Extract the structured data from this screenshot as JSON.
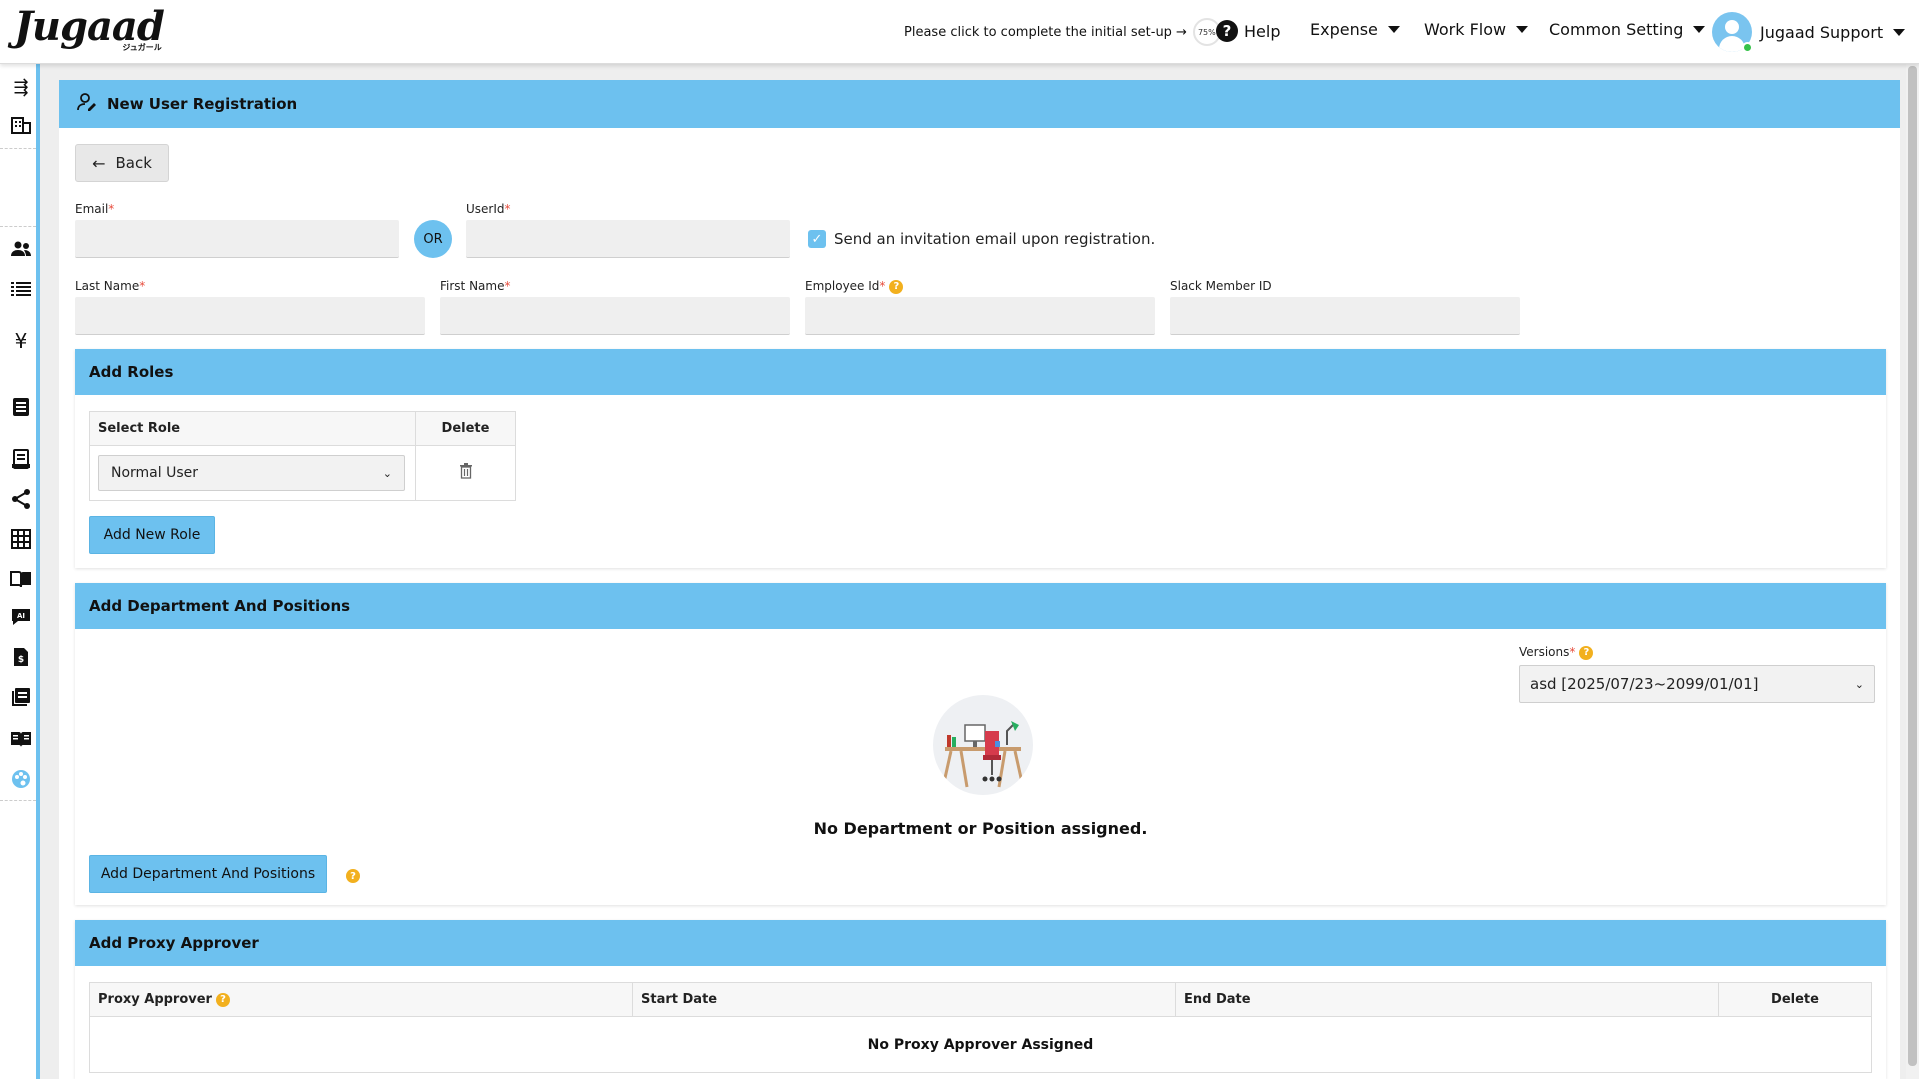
{
  "header": {
    "logo_text": "Jugaad",
    "logo_sub": "ジュガール",
    "setup_text": "Please click to complete the initial set-up",
    "setup_arrow": "→",
    "setup_progress": "75%",
    "help_label": "Help",
    "nav": [
      "Expense",
      "Work Flow",
      "Common Setting"
    ],
    "user_name": "Jugaad Support"
  },
  "sidebar": {
    "icons": [
      "menu-collapse-icon",
      "building-icon",
      "users-icon",
      "list-icon",
      "yen-icon",
      "document-icon",
      "receipt-icon",
      "share-icon",
      "grid-icon",
      "book-icon",
      "ai-chat-icon",
      "invoice-icon",
      "journal-icon",
      "manual-icon",
      "palette-icon"
    ]
  },
  "page": {
    "title": "New User Registration",
    "back_label": "Back",
    "fields": {
      "email_label": "Email",
      "or_label": "OR",
      "userid_label": "UserId",
      "invite_label": "Send an invitation email upon registration.",
      "invite_checked": true,
      "lastname_label": "Last Name",
      "firstname_label": "First Name",
      "employeeid_label": "Employee Id",
      "slack_label": "Slack Member ID",
      "required_mark": "*",
      "help_mark": "?"
    },
    "roles": {
      "title": "Add Roles",
      "col_select": "Select Role",
      "col_delete": "Delete",
      "selected_role": "Normal User",
      "add_button": "Add New Role"
    },
    "departments": {
      "title": "Add Department And Positions",
      "versions_label": "Versions",
      "versions_value": "asd [2025/07/23~2099/01/01]",
      "empty_text": "No Department or Position assigned.",
      "add_button": "Add Department And Positions"
    },
    "proxy": {
      "title": "Add Proxy Approver",
      "columns": [
        "Proxy Approver",
        "Start Date",
        "End Date",
        "Delete"
      ],
      "empty_text": "No Proxy Approver Assigned"
    }
  },
  "colors": {
    "accent": "#6dc1ef",
    "required": "#e74c3c",
    "help": "#f2b01e"
  }
}
